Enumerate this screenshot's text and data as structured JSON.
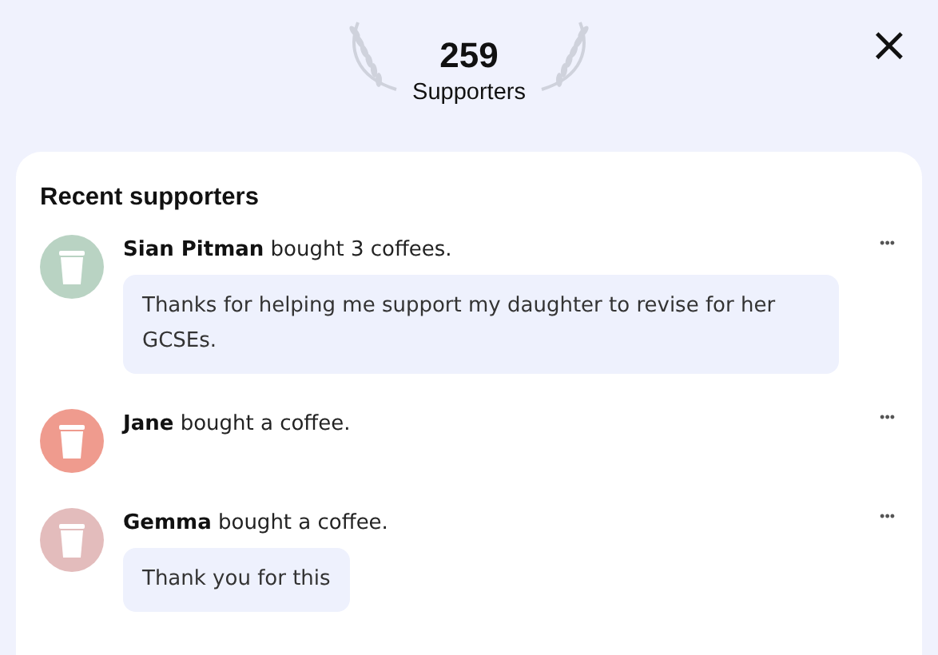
{
  "header": {
    "count": "259",
    "label": "Supporters",
    "close": "×"
  },
  "section_title": "Recent supporters",
  "supporters": [
    {
      "text": "**Sian Pitman** bought 3 coffees.",
      "color": "#b9d3c3",
      "message": "Thanks for helping me support my daughter to revise for her GCSEs.",
      "more": "•••"
    },
    {
      "text": "**Jane** bought a coffee.",
      "color": "#ef9b8e",
      "more": "•••"
    },
    {
      "text": "**Gemma** bought a coffee.",
      "color": "#e3bcbc",
      "message": "Thank you for this",
      "more": "•••"
    }
  ]
}
